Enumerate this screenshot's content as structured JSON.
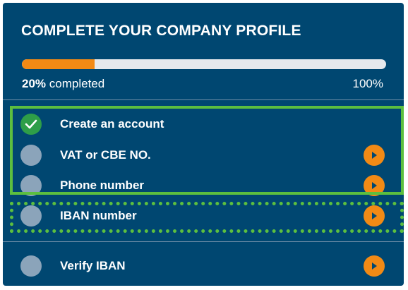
{
  "profile": {
    "title": "COMPLETE YOUR COMPANY PROFILE",
    "progress": {
      "value_percent": 20,
      "percent_label": "20%",
      "completed_label": "completed",
      "max_label": "100%"
    },
    "steps": [
      {
        "label": "Create an account",
        "status": "done",
        "has_action": false
      },
      {
        "label": "VAT or CBE NO.",
        "status": "pending",
        "has_action": true
      },
      {
        "label": "Phone number",
        "status": "pending",
        "has_action": true
      },
      {
        "label": "IBAN number",
        "status": "pending",
        "has_action": true
      },
      {
        "label": "Verify IBAN",
        "status": "pending",
        "has_action": true
      }
    ]
  },
  "colors": {
    "card_background": "#004771",
    "progress_fill": "#f28a15",
    "progress_track": "#e6e9ed",
    "done_check": "#2e9e48",
    "pending_circle": "#8ba4ba",
    "action_button": "#f28a15",
    "highlight": "#5cbf3f"
  },
  "icons": {
    "done": "check-icon",
    "action": "play-arrow-icon"
  }
}
